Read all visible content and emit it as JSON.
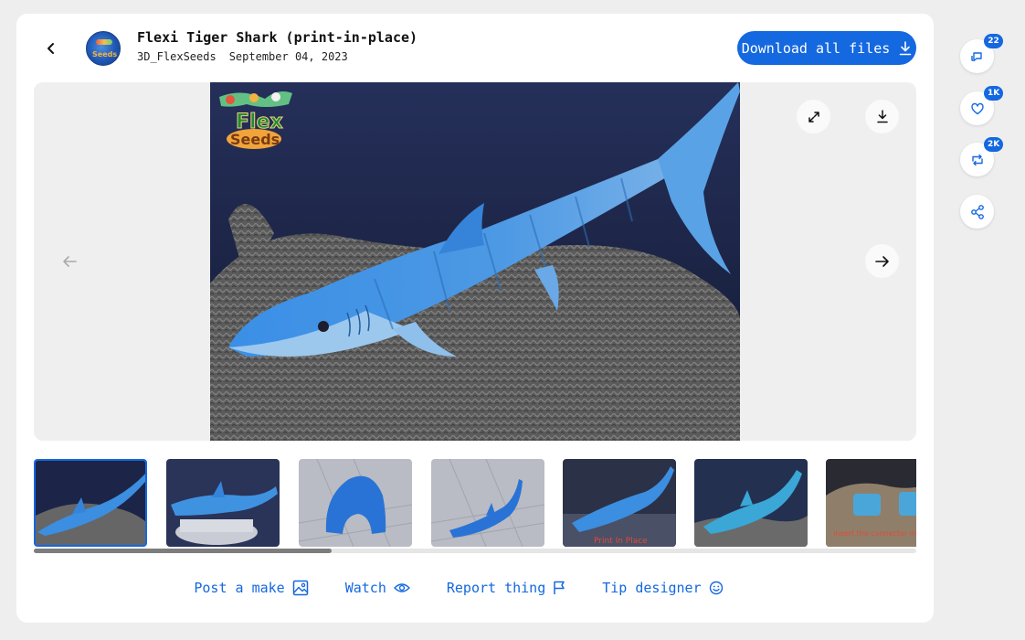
{
  "header": {
    "title": "Flexi Tiger Shark (print-in-place)",
    "author": "3D_FlexSeeds",
    "date": "September 04, 2023",
    "download_all_label": "Download all files"
  },
  "side_actions": [
    {
      "name": "comments",
      "icon": "comment-icon",
      "count": "22"
    },
    {
      "name": "likes",
      "icon": "heart-icon",
      "count": "1K"
    },
    {
      "name": "remix",
      "icon": "remix-icon",
      "count": "2K"
    },
    {
      "name": "share",
      "icon": "share-icon",
      "count": ""
    }
  ],
  "gallery": {
    "watermark_text": "Flex Seeds",
    "thumbnail_count": 7,
    "thumbnail_captions": [
      "Print In Place",
      "Insert the connector in the hole in the head to"
    ],
    "scroll_fraction_visible": 0.34
  },
  "actions": {
    "post_make": "Post a make",
    "watch": "Watch",
    "report": "Report thing",
    "tip": "Tip designer"
  },
  "colors": {
    "accent": "#1468e0",
    "shark_blue": "#3b8ee0",
    "backdrop": "#1c2547"
  }
}
